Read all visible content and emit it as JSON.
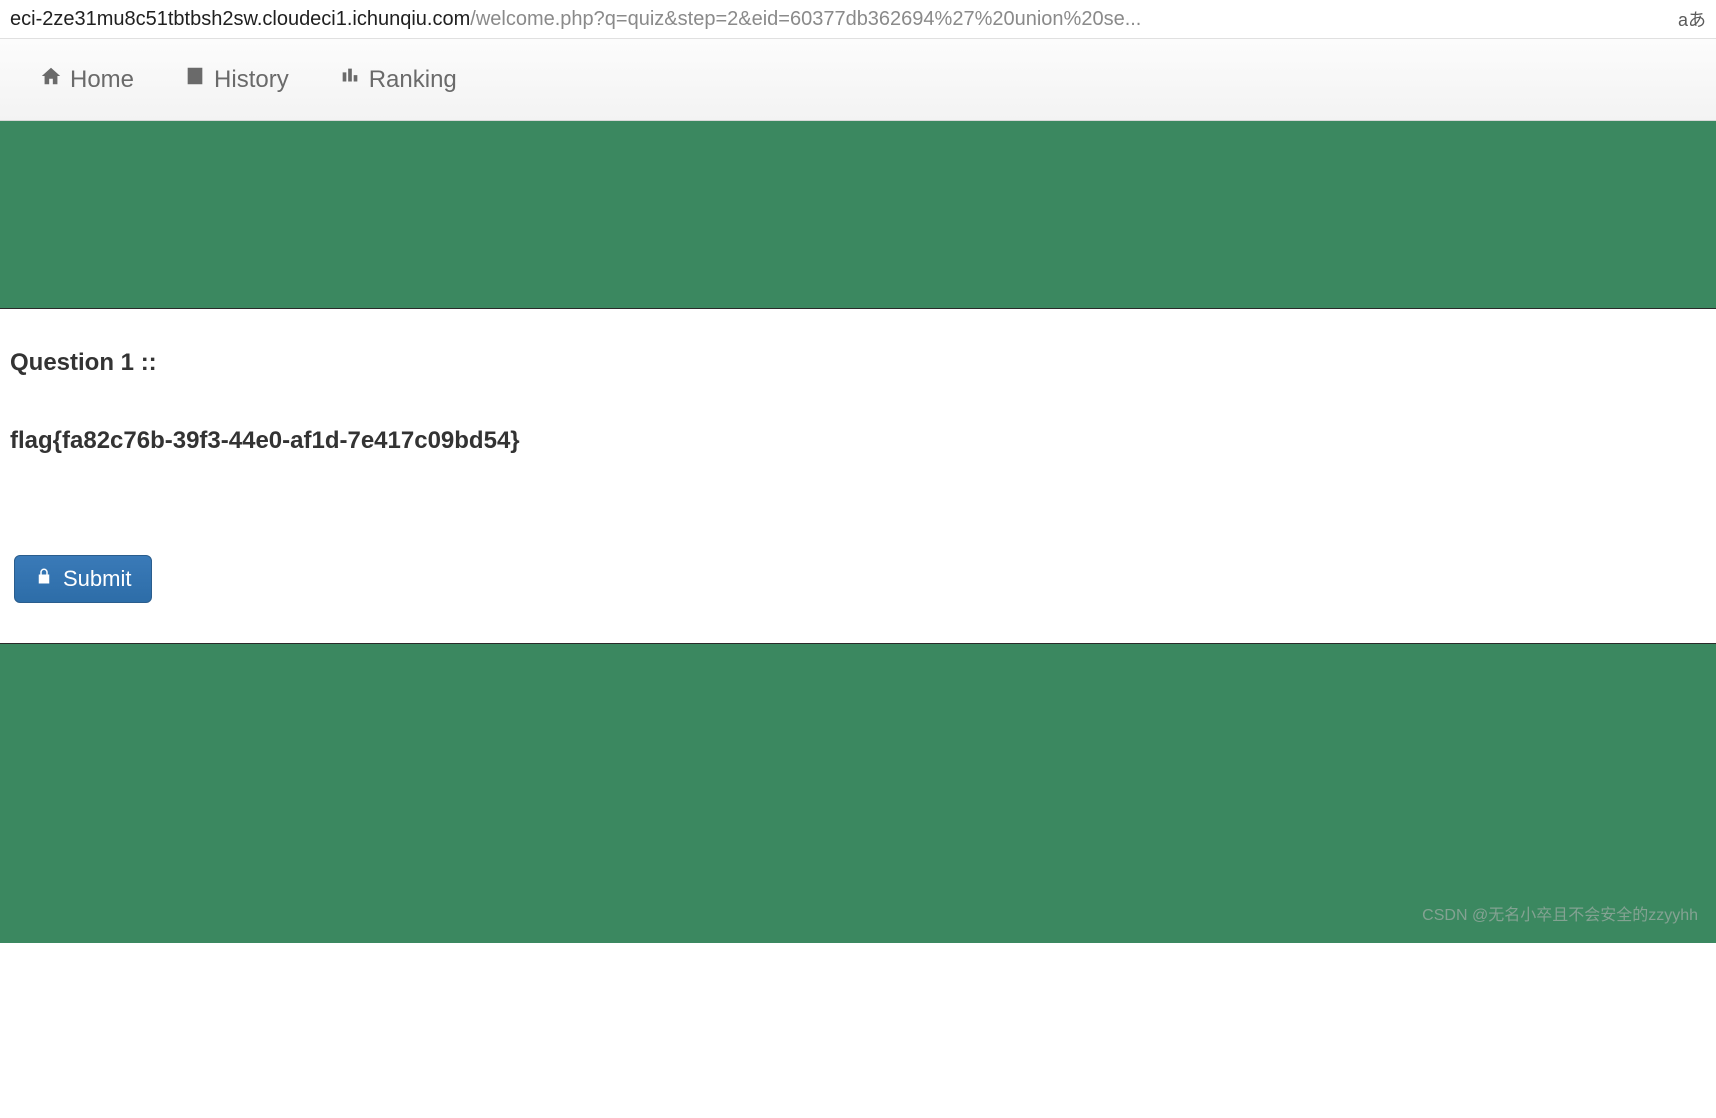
{
  "url": {
    "domain": "eci-2ze31mu8c51tbtbsh2sw.cloudeci1.ichunqiu.com",
    "path": "/welcome.php?q=quiz&step=2&eid=60377db362694%27%20union%20se...",
    "translate_icon": "aあ"
  },
  "nav": {
    "home": "Home",
    "history": "History",
    "ranking": "Ranking"
  },
  "content": {
    "question_header": "Question  1 ::",
    "flag": "flag{fa82c76b-39f3-44e0-af1d-7e417c09bd54}",
    "submit_label": "Submit"
  },
  "watermark": "CSDN @无名小卒且不会安全的zzyyhh"
}
